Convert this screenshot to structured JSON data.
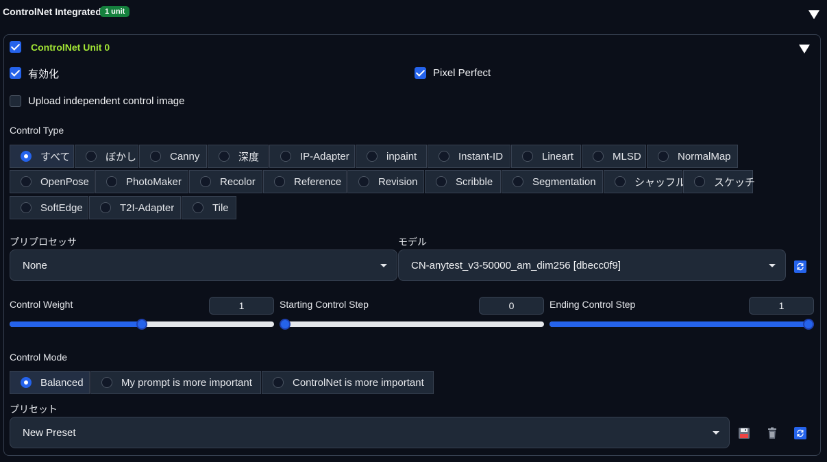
{
  "header": {
    "title": "ControlNet Integrated",
    "badge": "1 unit"
  },
  "unit": {
    "title": "ControlNet Unit 0",
    "enabled": {
      "label": "有効化",
      "checked": true
    },
    "pixel_perfect": {
      "label": "Pixel Perfect",
      "checked": true
    },
    "upload_independent": {
      "label": "Upload independent control image",
      "checked": false
    },
    "control_type": {
      "label": "Control Type",
      "options": [
        "すべて",
        "ぼかし",
        "Canny",
        "深度",
        "IP-Adapter",
        "inpaint",
        "Instant-ID",
        "Lineart",
        "MLSD",
        "NormalMap",
        "OpenPose",
        "PhotoMaker",
        "Recolor",
        "Reference",
        "Revision",
        "Scribble",
        "Segmentation",
        "シャッフル",
        "スケッチ",
        "SoftEdge",
        "T2I-Adapter",
        "Tile"
      ],
      "selected": "すべて"
    },
    "preprocessor": {
      "label": "プリプロセッサ",
      "value": "None"
    },
    "model": {
      "label": "モデル",
      "value": "CN-anytest_v3-50000_am_dim256 [dbecc0f9]"
    },
    "control_weight": {
      "label": "Control Weight",
      "value": "1",
      "fraction": 0.5
    },
    "starting_step": {
      "label": "Starting Control Step",
      "value": "0",
      "fraction": 0.0
    },
    "ending_step": {
      "label": "Ending Control Step",
      "value": "1",
      "fraction": 1.0
    },
    "control_mode": {
      "label": "Control Mode",
      "options": [
        "Balanced",
        "My prompt is more important",
        "ControlNet is more important"
      ],
      "selected": "Balanced"
    },
    "preset": {
      "label": "プリセット",
      "value": "New Preset"
    }
  },
  "colors": {
    "accent": "#2563eb",
    "unit_title": "#a3e635",
    "badge": "#15803d",
    "background": "#0b0f19"
  }
}
